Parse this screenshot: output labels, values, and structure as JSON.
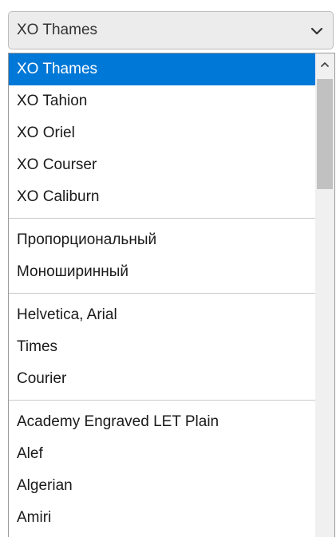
{
  "select": {
    "value": "XO Thames",
    "icon": "chevron-down-icon"
  },
  "dropdown": {
    "groups": [
      {
        "items": [
          {
            "label": "XO Thames",
            "selected": true
          },
          {
            "label": "XO Tahion"
          },
          {
            "label": "XO Oriel"
          },
          {
            "label": "XO Courser"
          },
          {
            "label": "XO Caliburn"
          }
        ]
      },
      {
        "items": [
          {
            "label": "Пропорциональный"
          },
          {
            "label": "Моноширинный"
          }
        ]
      },
      {
        "items": [
          {
            "label": "Helvetica, Arial"
          },
          {
            "label": "Times"
          },
          {
            "label": "Courier"
          }
        ]
      },
      {
        "items": [
          {
            "label": "Academy Engraved LET Plain"
          },
          {
            "label": "Alef"
          },
          {
            "label": "Algerian"
          },
          {
            "label": "Amiri"
          }
        ]
      }
    ],
    "scrollbar_up_icon": "chevron-up-icon",
    "selected_color": "#0078d7"
  }
}
